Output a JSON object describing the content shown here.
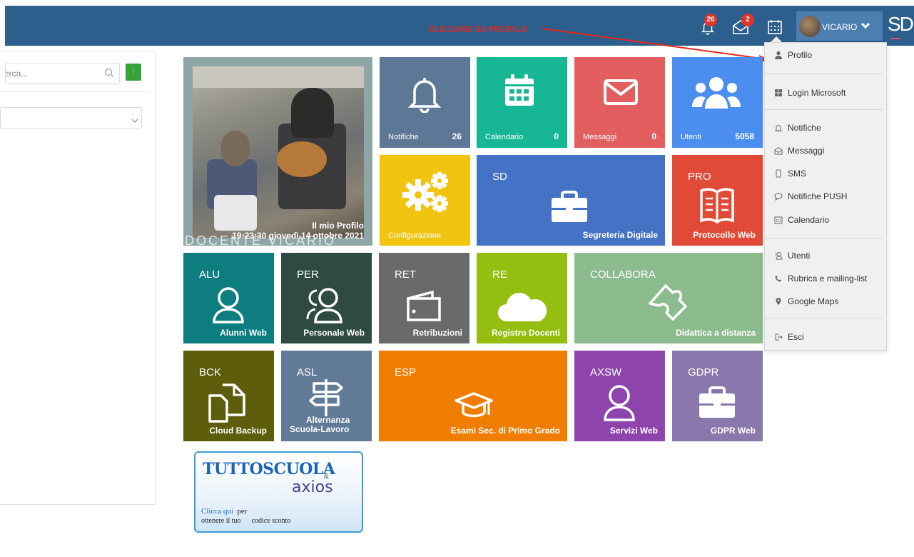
{
  "topbar": {
    "annotation": "CLICCARE SU PROFILO",
    "notifications_badge": "26",
    "messages_badge": "2",
    "user_name": "VICARIO",
    "logo": "SD"
  },
  "left_panel": {
    "search_placeholder": "erca..."
  },
  "profile_tile": {
    "label": "Il mio Profilo",
    "datetime": "19:23:30 giovedì 14 ottobre 2021",
    "ghost_text": "DOCENTE VICARIO"
  },
  "tiles": {
    "notifiche": {
      "label": "Notifiche",
      "count": "26"
    },
    "calendario": {
      "label": "Calendario",
      "count": "0"
    },
    "messaggi": {
      "label": "Messaggi",
      "count": "0"
    },
    "utenti": {
      "label": "Utenti",
      "count": "5058"
    },
    "configurazione": {
      "label": "Configurazione"
    },
    "sd": {
      "code": "SD",
      "label": "Segreteria Digitale"
    },
    "pro": {
      "code": "PRO",
      "label": "Protocollo Web"
    },
    "alu": {
      "code": "ALU",
      "label": "Alunni Web"
    },
    "per": {
      "code": "PER",
      "label": "Personale Web"
    },
    "ret": {
      "code": "RET",
      "label": "Retribuzioni"
    },
    "re": {
      "code": "RE",
      "label": "Registro Docenti"
    },
    "collabora": {
      "code": "COLLABORA",
      "label": "Didattica a distanza"
    },
    "bck": {
      "code": "BCK",
      "label": "Cloud Backup"
    },
    "asl": {
      "code": "ASL",
      "label_line1": "Alternanza",
      "label_line2": "Scuola-Lavoro"
    },
    "esp": {
      "code": "ESP",
      "label": "Esami Sec. di Primo Grado"
    },
    "axsw": {
      "code": "AXSW",
      "label": "Servizi Web"
    },
    "gdpr": {
      "code": "GDPR",
      "label": "GDPR Web"
    }
  },
  "dropdown": {
    "items": [
      {
        "label": "Profilo",
        "icon": "user-icon"
      },
      {
        "label": "Login Microsoft",
        "icon": "windows-icon"
      },
      {
        "label": "Notifiche",
        "icon": "bell-icon"
      },
      {
        "label": "Messaggi",
        "icon": "envelope-open-icon"
      },
      {
        "label": "SMS",
        "icon": "phone-icon"
      },
      {
        "label": "Notifiche PUSH",
        "icon": "comment-icon"
      },
      {
        "label": "Calendario",
        "icon": "calendar-icon"
      },
      {
        "label": "Utenti",
        "icon": "users-icon"
      },
      {
        "label": "Rubrica e mailing-list",
        "icon": "phone-handset-icon"
      },
      {
        "label": "Google Maps",
        "icon": "map-marker-icon"
      },
      {
        "label": "Esci",
        "icon": "sign-out-icon"
      }
    ]
  },
  "ad": {
    "title": "TUTTOSCUOLA",
    "amp": "&",
    "brand": "axios",
    "line1_link": "Clicca qui",
    "line1_rest": "per",
    "line2_a": "ottenere il tuo",
    "line2_b": "codice sconto"
  },
  "colors": {
    "topbar": "#2d5f8c",
    "annotation": "#e8261e",
    "badge": "#e0352b"
  }
}
